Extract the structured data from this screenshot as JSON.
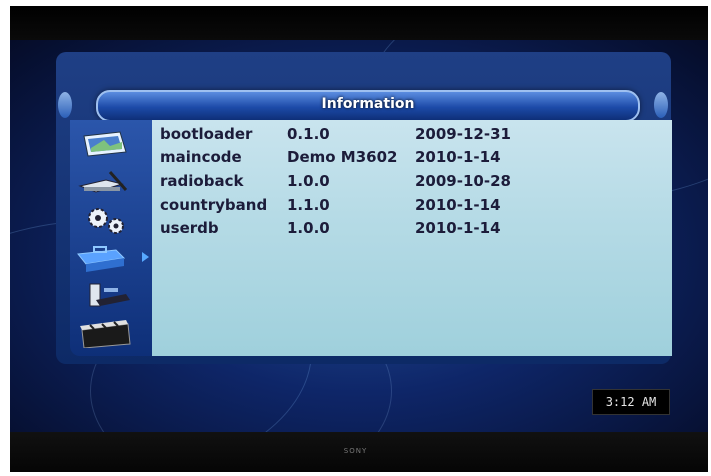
{
  "window": {
    "title": "Information"
  },
  "sidebar": {
    "items": [
      {
        "icon": "picture-icon"
      },
      {
        "icon": "install-tools-icon"
      },
      {
        "icon": "gears-icon"
      },
      {
        "icon": "toolbox-icon",
        "selected": true
      },
      {
        "icon": "usb-media-icon"
      },
      {
        "icon": "clapperboard-icon"
      }
    ]
  },
  "info_table": {
    "rows": [
      {
        "name": "bootloader",
        "version": "0.1.0",
        "date": "2009-12-31"
      },
      {
        "name": "maincode",
        "version": "Demo M3602",
        "date": "2010-1-14"
      },
      {
        "name": "radioback",
        "version": "1.0.0",
        "date": "2009-10-28"
      },
      {
        "name": "countryband",
        "version": "1.1.0",
        "date": "2010-1-14"
      },
      {
        "name": "userdb",
        "version": "1.0.0",
        "date": "2010-1-14"
      }
    ]
  },
  "status": {
    "clock": "3:12 AM"
  },
  "tv": {
    "brand": "SONY"
  },
  "colors": {
    "accent": "#1c4aa8",
    "content_bg": "#b6dbe6",
    "text": "#1c1c3a"
  }
}
